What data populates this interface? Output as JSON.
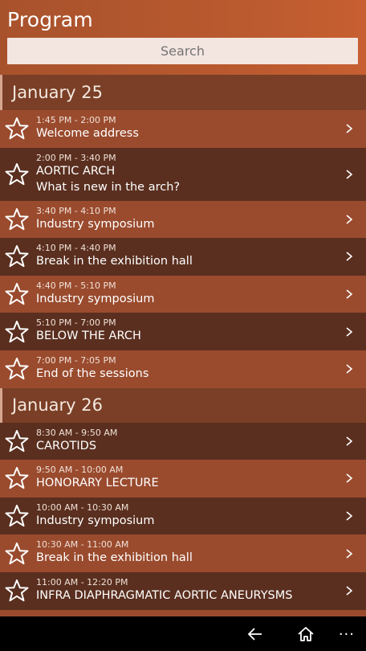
{
  "header": {
    "title": "Program"
  },
  "search": {
    "placeholder": "Search"
  },
  "days": [
    {
      "label": "January 25",
      "items": [
        {
          "time": "1:45 PM - 2:00 PM",
          "title": "Welcome address"
        },
        {
          "time": "2:00 PM - 3:40 PM",
          "title": "AORTIC ARCH",
          "subtitle": "What is new in the arch?"
        },
        {
          "time": "3:40 PM - 4:10 PM",
          "title": "Industry symposium"
        },
        {
          "time": "4:10 PM - 4:40 PM",
          "title": "Break in the exhibition hall"
        },
        {
          "time": "4:40 PM - 5:10 PM",
          "title": "Industry symposium"
        },
        {
          "time": "5:10 PM - 7:00 PM",
          "title": "BELOW THE ARCH"
        },
        {
          "time": "7:00 PM - 7:05 PM",
          "title": "End of the sessions"
        }
      ]
    },
    {
      "label": "January 26",
      "items": [
        {
          "time": "8:30 AM - 9:50 AM",
          "title": "CAROTIDS"
        },
        {
          "time": "9:50 AM - 10:00 AM",
          "title": "HONORARY LECTURE"
        },
        {
          "time": "10:00 AM - 10:30 AM",
          "title": "Industry symposium"
        },
        {
          "time": "10:30 AM - 11:00 AM",
          "title": "Break in the exhibition hall"
        },
        {
          "time": "11:00 AM - 12:20 PM",
          "title": "INFRA DIAPHRAGMATIC AORTIC ANEURYSMS"
        }
      ]
    }
  ],
  "navbar": {
    "more": "···"
  },
  "colors": {
    "accent": "#b8592f",
    "row_light": "#9a4b2e",
    "row_dark": "#5a2f1f"
  },
  "icons": {
    "favorite": "star-outline-icon",
    "open": "chevron-right-icon",
    "back": "back-arrow-icon",
    "home": "home-icon",
    "more": "more-dots-icon"
  }
}
